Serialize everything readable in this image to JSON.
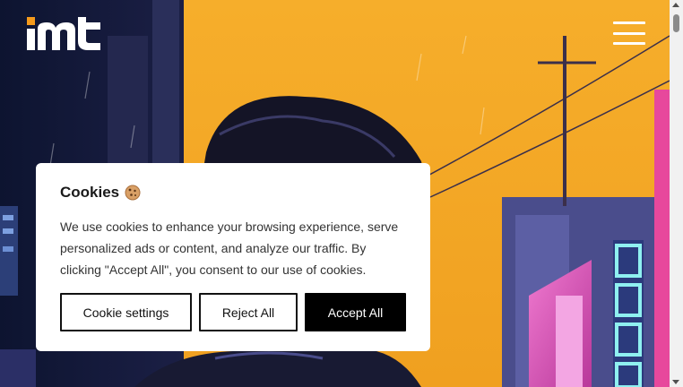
{
  "brand": {
    "logo_alt": "mt"
  },
  "header": {
    "menu_icon": "hamburger-menu-icon"
  },
  "cookie_banner": {
    "title": "Cookies",
    "title_icon": "cookie-icon",
    "message": "We use cookies to enhance your browsing experience, serve personalized ads or content, and analyze our traffic. By clicking \"Accept All\", you consent to our use of cookies.",
    "buttons": {
      "settings": "Cookie settings",
      "reject": "Reject All",
      "accept": "Accept All"
    }
  },
  "colors": {
    "hero_orange": "#f2a825",
    "logo_accent": "#f59a1b",
    "accept_bg": "#000000",
    "dialog_bg": "#ffffff"
  }
}
